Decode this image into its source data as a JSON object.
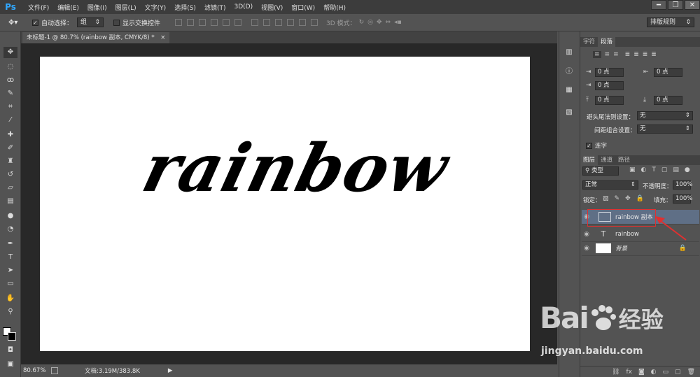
{
  "app": {
    "logo": "Ps"
  },
  "menu": [
    "文件(F)",
    "编辑(E)",
    "图像(I)",
    "图层(L)",
    "文字(Y)",
    "选择(S)",
    "滤镜(T)",
    "3D(D)",
    "视图(V)",
    "窗口(W)",
    "帮助(H)"
  ],
  "window_controls": {
    "minimize": "━",
    "restore": "❐",
    "close": "✕"
  },
  "options": {
    "auto_select_label": "自动选择：",
    "auto_select_value": "组",
    "show_transform_label": "显示交换控件",
    "mode_3d_label": "3D 模式：",
    "workspace": "排版规则"
  },
  "document": {
    "tab_title": "未标题-1 @ 80.7% (rainbow 副本, CMYK/8) *",
    "close": "×",
    "canvas_text": "rainbow"
  },
  "status": {
    "zoom": "80.67%",
    "doc_info": "文档:3.19M/383.8K",
    "arrow": "▶"
  },
  "paragraph_panel": {
    "tabs": [
      "字符",
      "段落"
    ],
    "indent_left": "0 点",
    "indent_right": "0 点",
    "first_line": "0 点",
    "space_before": "0 点",
    "space_after": "0 点",
    "kinsoku_label": "避头尾法则设置：",
    "kinsoku_value": "无",
    "mojikumi_label": "间距组合设置：",
    "mojikumi_value": "无",
    "hyphenate_label": "连字"
  },
  "layers_panel": {
    "tabs": [
      "图层",
      "通道",
      "路径"
    ],
    "filter_label": "类型",
    "blend_mode": "正常",
    "opacity_label": "不透明度：",
    "opacity_value": "100%",
    "lock_label": "锁定：",
    "fill_label": "填充：",
    "fill_value": "100%",
    "layers": [
      {
        "name": "rainbow 副本",
        "selected": true
      },
      {
        "name": "rainbow",
        "selected": false
      },
      {
        "name": "背景",
        "selected": false
      }
    ]
  },
  "watermark": {
    "brand": "Bai",
    "brand_cn": "经验",
    "url": "jingyan.baidu.com"
  },
  "colors": {
    "selection": "#5f6f86",
    "highlight_red": "#e03030",
    "canvas": "#ffffff"
  }
}
